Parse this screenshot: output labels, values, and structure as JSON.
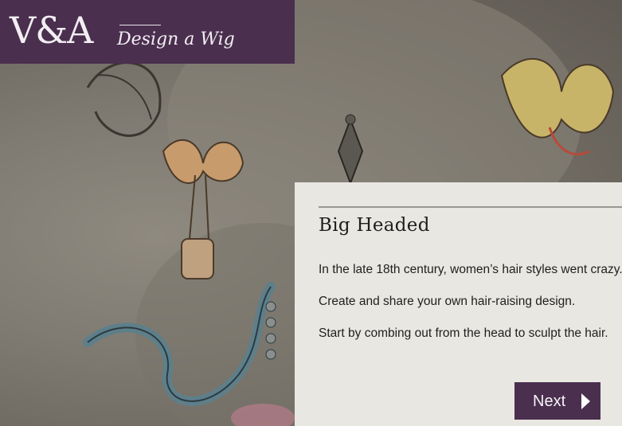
{
  "header": {
    "logo_text": "V&A",
    "title": "Design a Wig"
  },
  "intro": {
    "heading": "Big Headed",
    "paragraphs": [
      "In the late 18th century, women’s hair styles went crazy.",
      "Create and share your own hair-raising design.",
      "Start by combing out from the head to sculpt the hair."
    ],
    "next_label": "Next",
    "next_icon": "play-arrow-icon"
  },
  "colors": {
    "brand_purple": "#4a2f4f",
    "panel_background": "#e9e7e2"
  }
}
